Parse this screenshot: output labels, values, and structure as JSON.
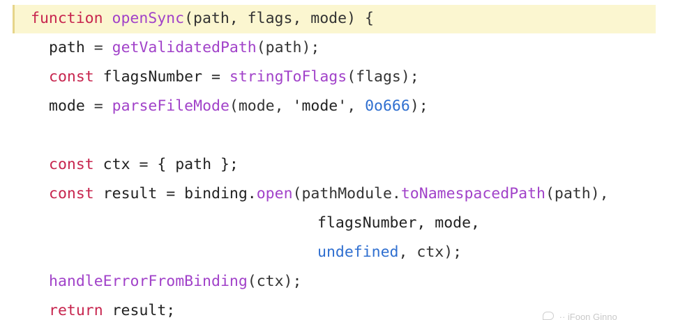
{
  "editor": {
    "lines": [
      [
        {
          "t": "function",
          "c": "kw"
        },
        {
          "t": " ",
          "c": "id"
        },
        {
          "t": "openSync",
          "c": "fn"
        },
        {
          "t": "(path, flags, mode) {",
          "c": "pr"
        }
      ],
      [
        {
          "t": "path",
          "c": "id"
        },
        {
          "t": " = ",
          "c": "pr"
        },
        {
          "t": "getValidatedPath",
          "c": "fn"
        },
        {
          "t": "(path);",
          "c": "pr"
        }
      ],
      [
        {
          "t": "const",
          "c": "kw"
        },
        {
          "t": " flagsNumber = ",
          "c": "id"
        },
        {
          "t": "stringToFlags",
          "c": "fn"
        },
        {
          "t": "(flags);",
          "c": "pr"
        }
      ],
      [
        {
          "t": "mode",
          "c": "id"
        },
        {
          "t": " = ",
          "c": "pr"
        },
        {
          "t": "parseFileMode",
          "c": "fn"
        },
        {
          "t": "(mode, ",
          "c": "pr"
        },
        {
          "t": "'mode'",
          "c": "st"
        },
        {
          "t": ", ",
          "c": "pr"
        },
        {
          "t": "0o666",
          "c": "nm"
        },
        {
          "t": ");",
          "c": "pr"
        }
      ],
      [],
      [
        {
          "t": "const",
          "c": "kw"
        },
        {
          "t": " ctx = { path };",
          "c": "id"
        }
      ],
      [
        {
          "t": "const",
          "c": "kw"
        },
        {
          "t": " result = binding.",
          "c": "id"
        },
        {
          "t": "open",
          "c": "fn"
        },
        {
          "t": "(pathModule.",
          "c": "pr"
        },
        {
          "t": "toNamespacedPath",
          "c": "fn"
        },
        {
          "t": "(path),",
          "c": "pr"
        }
      ],
      [
        {
          "t": "flagsNumber, mode,",
          "c": "id"
        }
      ],
      [
        {
          "t": "undefined",
          "c": "nm"
        },
        {
          "t": ", ctx);",
          "c": "pr"
        }
      ],
      [
        {
          "t": "handleErrorFromBinding",
          "c": "fn"
        },
        {
          "t": "(ctx);",
          "c": "pr"
        }
      ],
      [
        {
          "t": "return",
          "c": "kw"
        },
        {
          "t": " result;",
          "c": "id"
        }
      ]
    ]
  },
  "colors": {
    "keyword": "#c7254e",
    "function": "#a142c9",
    "number_literal": "#2f6fd0",
    "identifier": "#222222",
    "current_line_bg": "#fbf6d0",
    "current_line_bar": "#e6d58a"
  },
  "watermark": {
    "text": "·· iFoon Ginno"
  }
}
